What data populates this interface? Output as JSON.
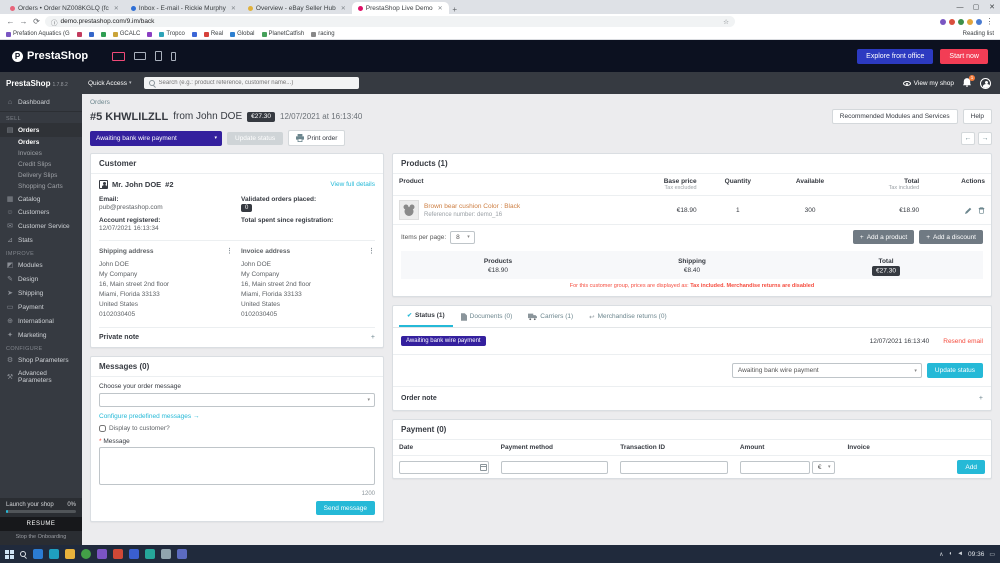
{
  "colors": {
    "accent": "#25b9d7",
    "status_purple": "#34209e",
    "danger": "#f54c3e",
    "dark": "#363a41",
    "start_red": "#f23d55",
    "explore_blue": "#2c3ac1"
  },
  "browser": {
    "tabs": [
      {
        "label": "Orders • Order NZ008KGLQ (fc"
      },
      {
        "label": "Inbox - E-mail - Rickie Murphy"
      },
      {
        "label": "Overview - eBay Seller Hub"
      },
      {
        "label": "PrestaShop Live Demo"
      }
    ],
    "url": "demo.prestashop.com/9.im/back",
    "bookmarks": [
      "Prefation Aquatics (G",
      "GCALC",
      "Tropco",
      "Real",
      "Global",
      "PlanetCatfish",
      "racing"
    ],
    "reading_list": "Reading list"
  },
  "ps_header": {
    "brand": "PrestaShop",
    "explore": "Explore front office",
    "start": "Start now"
  },
  "admin_bar": {
    "brand": "PrestaShop",
    "version": "1.7.8.2",
    "quick_access": "Quick Access",
    "search_placeholder": "Search (e.g.: product reference, customer name...)",
    "view_shop": "View my shop",
    "badge": "1"
  },
  "sidebar": {
    "dashboard": "Dashboard",
    "sell_header": "SELL",
    "orders": "Orders",
    "orders_sub": [
      "Orders",
      "Invoices",
      "Credit Slips",
      "Delivery Slips",
      "Shopping Carts"
    ],
    "sell_items": [
      "Catalog",
      "Customers",
      "Customer Service",
      "Stats"
    ],
    "improve_header": "IMPROVE",
    "improve_items": [
      "Modules",
      "Design",
      "Shipping",
      "Payment",
      "International",
      "Marketing"
    ],
    "configure_header": "CONFIGURE",
    "configure_items": [
      "Shop Parameters",
      "Advanced Parameters"
    ],
    "onboarding_title": "Launch your shop",
    "onboarding_percent": "0%",
    "resume": "RESUME",
    "stop": "Stop the Onboarding"
  },
  "page": {
    "breadcrumb": "Orders",
    "order_id": "#5 KHWLILZLL",
    "from": "from John DOE",
    "total_badge": "€27.30",
    "date": "12/07/2021 at 16:13:40",
    "recommended": "Recommended Modules and Services",
    "help": "Help",
    "status_select": "Awaiting bank wire payment",
    "update_status": "Update status",
    "print_order": "Print order"
  },
  "customer": {
    "title": "Customer",
    "name": "Mr. John DOE",
    "id": "#2",
    "view_details": "View full details",
    "email_label": "Email:",
    "email": "pub@prestashop.com",
    "validated_label": "Validated orders placed:",
    "validated_count": "0",
    "registered_label": "Account registered:",
    "registered_date": "12/07/2021 16:13:34",
    "spent_label": "Total spent since registration:",
    "shipping_title": "Shipping address",
    "invoice_title": "Invoice address",
    "address_lines": [
      "John DOE",
      "My Company",
      "16, Main street 2nd floor",
      "Miami, Florida 33133",
      "United States",
      "0102030405"
    ],
    "private_note": "Private note"
  },
  "messages": {
    "title": "Messages (0)",
    "choose_label": "Choose your order message",
    "configure_link": "Configure predefined messages →",
    "display_label": "Display to customer?",
    "message_label": "Message",
    "char_count": "1200",
    "send": "Send message"
  },
  "products": {
    "title": "Products (1)",
    "columns": [
      {
        "label": "Product",
        "sub": ""
      },
      {
        "label": "Base price",
        "sub": "Tax excluded"
      },
      {
        "label": "Quantity",
        "sub": ""
      },
      {
        "label": "Available",
        "sub": ""
      },
      {
        "label": "Total",
        "sub": "Tax included"
      },
      {
        "label": "Actions",
        "sub": ""
      }
    ],
    "row": {
      "name": "Brown bear cushion Color : Black",
      "reference": "Reference number: demo_16",
      "base_price": "€18.90",
      "quantity": "1",
      "available": "300",
      "total": "€18.90"
    },
    "items_per_page_label": "Items per page:",
    "items_per_page": "8",
    "add_product": "Add a product",
    "add_discount": "Add a discount",
    "summary": {
      "products_label": "Products",
      "products_value": "€18.90",
      "shipping_label": "Shipping",
      "shipping_value": "€8.40",
      "total_label": "Total",
      "total_value": "€27.30"
    },
    "note": {
      "text1": "For this customer group, prices are displayed as:",
      "bold1": "Tax included.",
      "text2": "Merchandise returns are disabled"
    }
  },
  "status_tabs": {
    "tabs": [
      {
        "label": "Status (1)"
      },
      {
        "label": "Documents (0)"
      },
      {
        "label": "Carriers (1)"
      },
      {
        "label": "Merchandise returns (0)"
      }
    ],
    "badge": "Awaiting bank wire payment",
    "date": "12/07/2021 16:13:40",
    "resend": "Resend email",
    "select": "Awaiting bank wire payment",
    "update": "Update status",
    "order_note": "Order note"
  },
  "payment": {
    "title": "Payment (0)",
    "columns": [
      "Date",
      "Payment method",
      "Transaction ID",
      "Amount",
      "Invoice"
    ],
    "currency": "€",
    "add": "Add"
  },
  "taskbar": {
    "time": "09:36"
  }
}
